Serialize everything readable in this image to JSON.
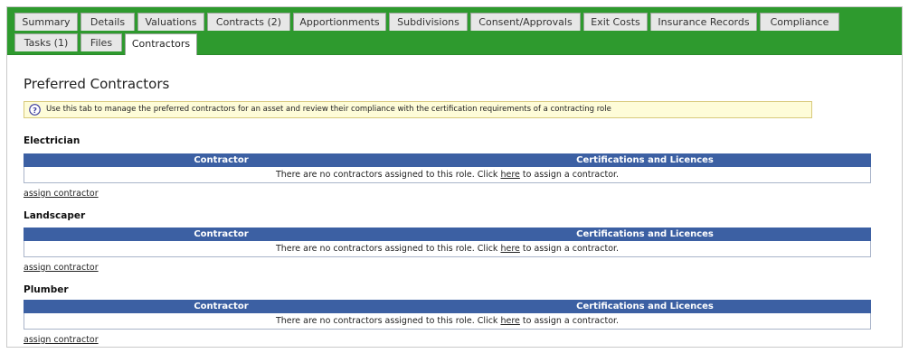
{
  "tabs": {
    "row1": [
      {
        "label": "Summary",
        "active": false
      },
      {
        "label": "Details",
        "active": false
      },
      {
        "label": "Valuations",
        "active": false
      },
      {
        "label": "Contracts (2)",
        "active": false
      },
      {
        "label": "Apportionments",
        "active": false
      },
      {
        "label": "Subdivisions",
        "active": false
      },
      {
        "label": "Consent/Approvals",
        "active": false
      },
      {
        "label": "Exit Costs",
        "active": false
      },
      {
        "label": "Insurance Records",
        "active": false
      },
      {
        "label": "Compliance",
        "active": false
      }
    ],
    "row2": [
      {
        "label": "Tasks (1)",
        "active": false
      },
      {
        "label": "Files",
        "active": false
      },
      {
        "label": "Contractors",
        "active": true
      }
    ]
  },
  "page_title": "Preferred Contractors",
  "info": {
    "icon": "help-icon",
    "text": "Use this tab to manage the preferred contractors for an asset and review their compliance with the certification requirements of a contracting role"
  },
  "table_headers": {
    "contractor": "Contractor",
    "certifications": "Certifications and Licences"
  },
  "empty_message": {
    "before": "There are no contractors assigned to this role. Click ",
    "link": "here",
    "after": " to assign a contractor."
  },
  "assign_link": "assign contractor",
  "roles": [
    {
      "name": "Electrician"
    },
    {
      "name": "Landscaper"
    },
    {
      "name": "Plumber"
    }
  ],
  "colors": {
    "tab_bar": "#2e9a2e",
    "table_header": "#3c60a3",
    "info_background": "#fefcd8"
  }
}
